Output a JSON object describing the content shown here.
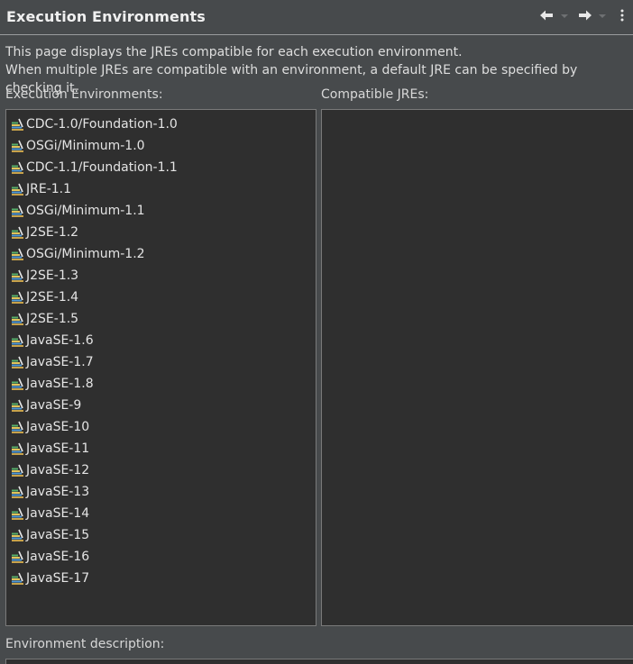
{
  "header": {
    "title": "Execution Environments"
  },
  "description": {
    "line1": "This page displays the JREs compatible for each execution environment.",
    "line2": "When multiple JREs are compatible with an environment, a default JRE can be specified by checking it."
  },
  "labels": {
    "environments": "Execution Environments:",
    "compatible_jres": "Compatible JREs:",
    "environment_description": "Environment description:"
  },
  "environments": [
    "CDC-1.0/Foundation-1.0",
    "OSGi/Minimum-1.0",
    "CDC-1.1/Foundation-1.1",
    "JRE-1.1",
    "OSGi/Minimum-1.1",
    "J2SE-1.2",
    "OSGi/Minimum-1.2",
    "J2SE-1.3",
    "J2SE-1.4",
    "J2SE-1.5",
    "JavaSE-1.6",
    "JavaSE-1.7",
    "JavaSE-1.8",
    "JavaSE-9",
    "JavaSE-10",
    "JavaSE-11",
    "JavaSE-12",
    "JavaSE-13",
    "JavaSE-14",
    "JavaSE-15",
    "JavaSE-16",
    "JavaSE-17"
  ],
  "compatible_jres": [],
  "icons": {
    "back": "arrow-left-icon",
    "forward": "arrow-right-icon",
    "menu": "vertical-ellipsis-icon",
    "environment": "library-books-icon"
  },
  "colors": {
    "background": "#474a4c",
    "list_background": "#2f2f2f",
    "text": "#e4e4e4"
  }
}
